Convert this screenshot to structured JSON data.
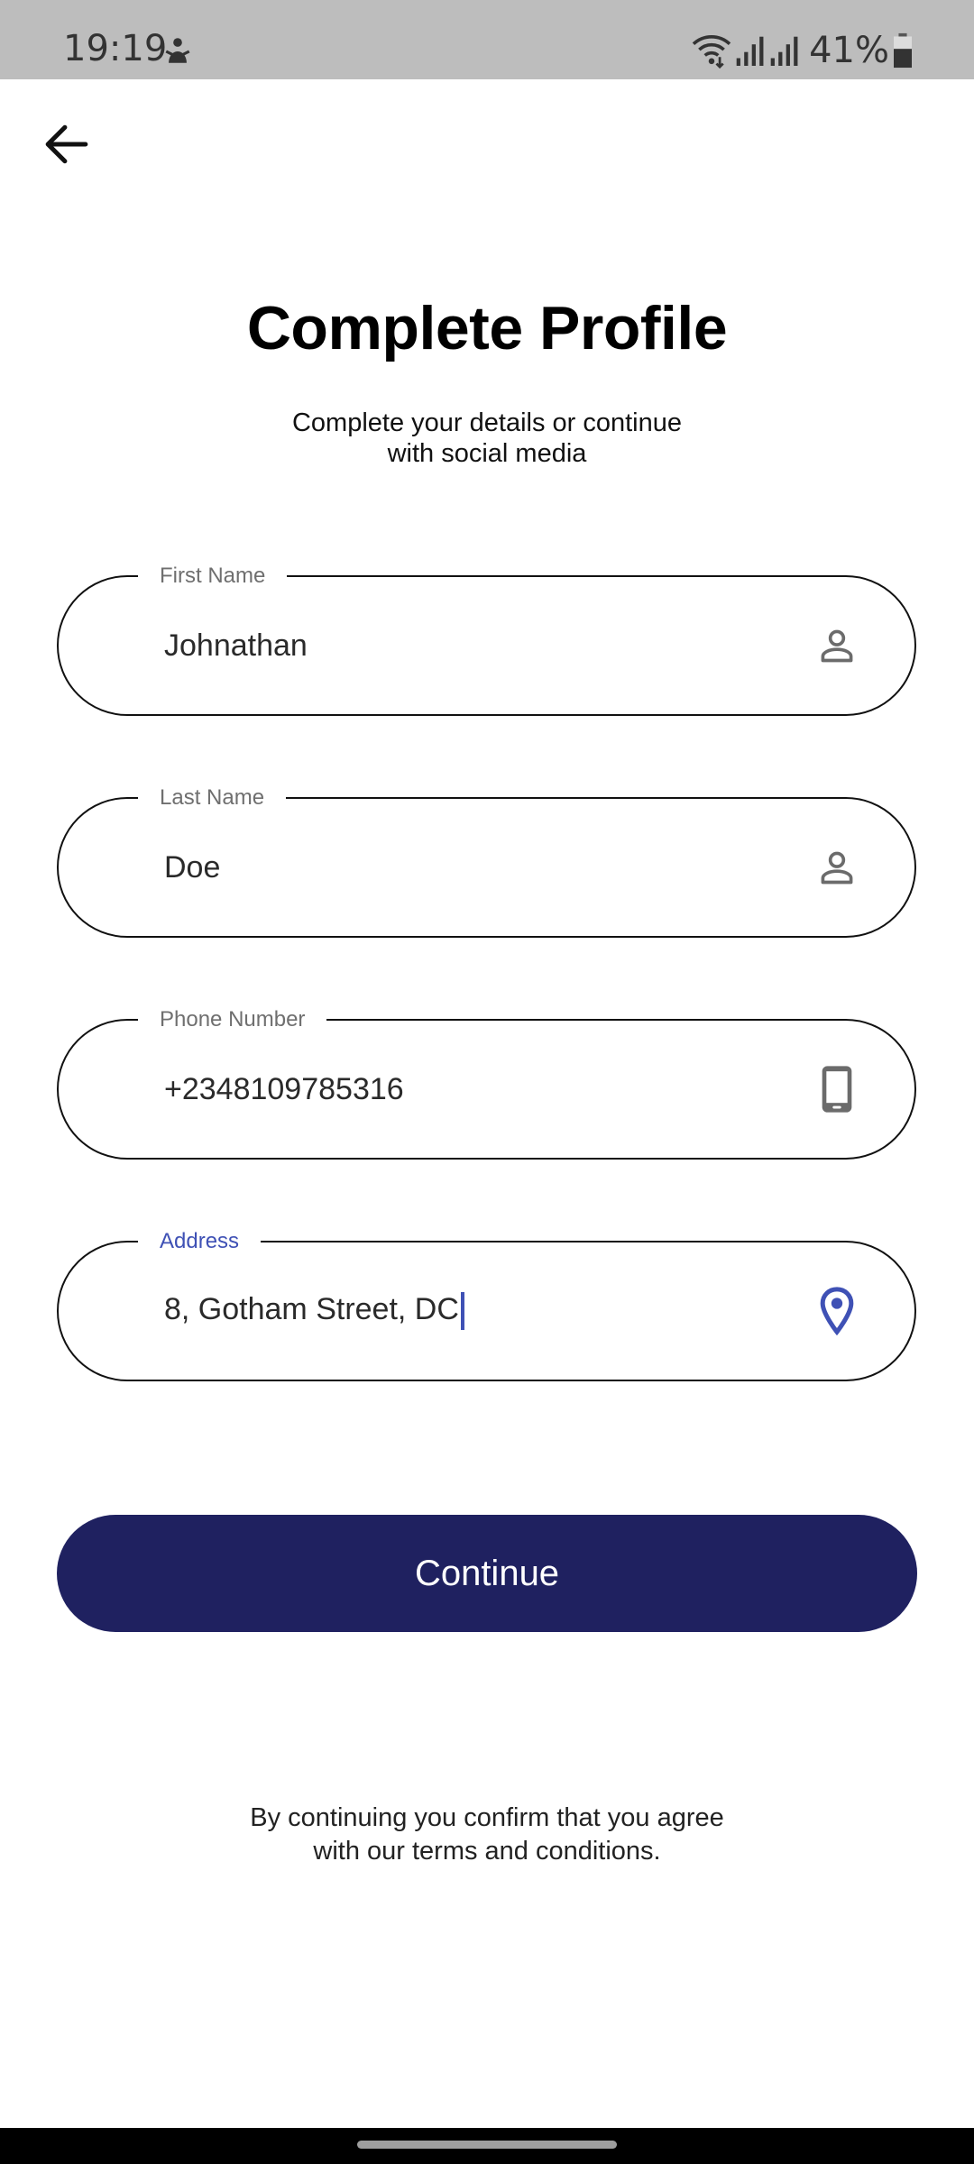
{
  "status_bar": {
    "time": "19:19",
    "battery_percent": "41%"
  },
  "header": {
    "title": "Complete Profile",
    "subtitle_line1": "Complete your details or continue",
    "subtitle_line2": "with social media"
  },
  "form": {
    "first_name": {
      "label": "First Name",
      "value": "Johnathan",
      "icon": "person-icon"
    },
    "last_name": {
      "label": "Last Name",
      "value": "Doe",
      "icon": "person-icon"
    },
    "phone": {
      "label": "Phone Number",
      "value": "+2348109785316",
      "icon": "phone-icon"
    },
    "address": {
      "label": "Address",
      "value": "8, Gotham Street, DC",
      "icon": "location-pin-icon"
    }
  },
  "continue_label": "Continue",
  "terms_line1": "By continuing you confirm that you agree",
  "terms_line2": "with our terms and conditions.",
  "colors": {
    "primary": "#1f2160",
    "focus": "#3f51b5",
    "status_bar": "#bdbdbd"
  }
}
